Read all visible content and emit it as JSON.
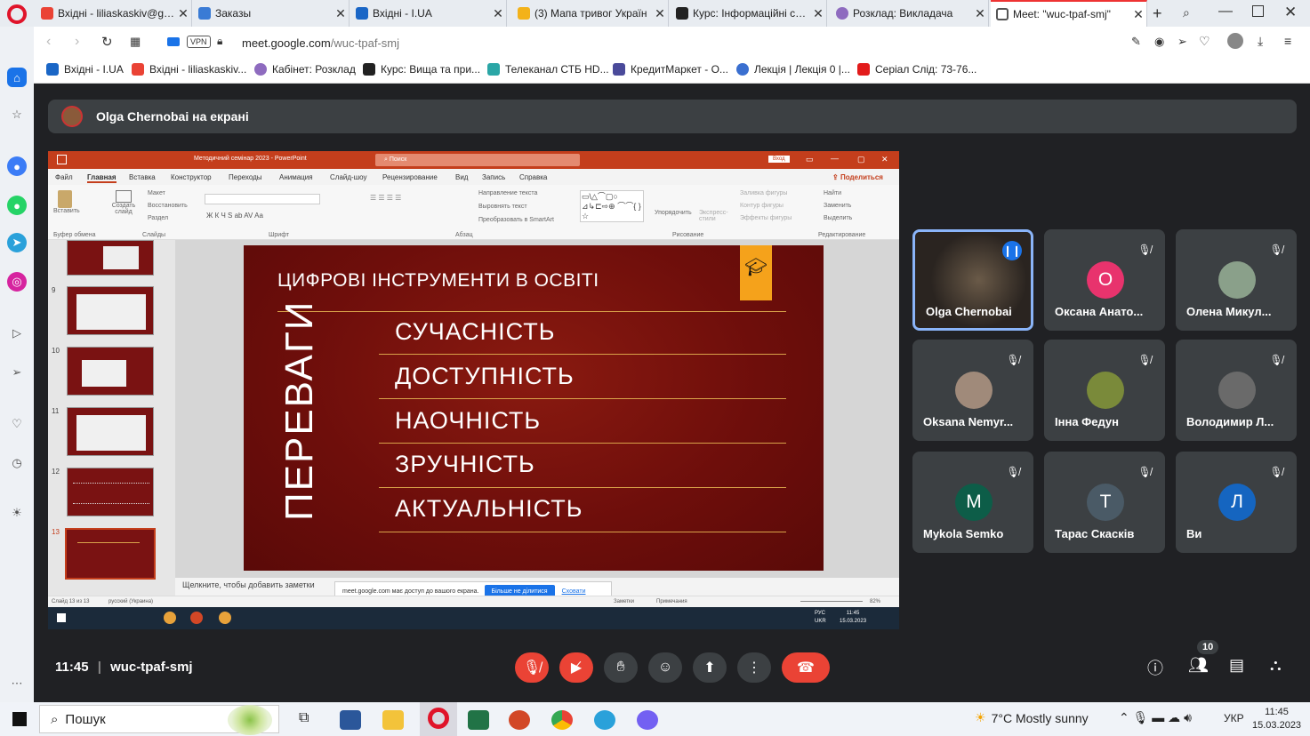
{
  "browser": {
    "tabs": [
      {
        "label": "Вхідні - liliaskaskiv@gma",
        "color": "#ea4335"
      },
      {
        "label": "Заказы",
        "color": "#3a7bd5"
      },
      {
        "label": "Вхідні - I.UA",
        "color": "#1a66c6"
      },
      {
        "label": "(3) Мапа тривог Україн",
        "color": "#f3b21a"
      },
      {
        "label": "Курс: Інформаційні сист",
        "color": "#222222"
      },
      {
        "label": "Розклад: Викладача",
        "color": "#8e6bbf"
      },
      {
        "label": "Meet: \"wuc-tpaf-smj\"",
        "color": "#1a73e8"
      }
    ],
    "url_domain": "meet.google.com",
    "url_path": "/wuc-tpaf-smj",
    "vpn_label": "VPN",
    "bookmarks": [
      {
        "label": "Вхідні - I.UA",
        "color": "#1a66c6"
      },
      {
        "label": "Вхідні - liliaskaskiv...",
        "color": "#ea4335"
      },
      {
        "label": "Кабінет: Розклад",
        "color": "#8e6bbf"
      },
      {
        "label": "Курс: Вища та при...",
        "color": "#222222"
      },
      {
        "label": "Телеканал СТБ HD...",
        "color": "#2aa6a6"
      },
      {
        "label": "КредитМаркет - О...",
        "color": "#4a4a9a"
      },
      {
        "label": "Лекція | Лекція 0 |...",
        "color": "#3a6fd0"
      },
      {
        "label": "Серіал Слід: 73-76...",
        "color": "#e21b1b"
      }
    ]
  },
  "meet": {
    "presenter_text": "Olga Chernobai на екрані",
    "time": "11:45",
    "meeting_code": "wuc-tpaf-smj",
    "participants_count": "10",
    "tiles": [
      {
        "name": "Olga Chernobai",
        "initial": "",
        "color": "#5a4a3a",
        "speaking": true
      },
      {
        "name": "Оксана Анато...",
        "initial": "О",
        "color": "#e8336d"
      },
      {
        "name": "Олена Микул...",
        "initial": "",
        "color": "#8aa08a"
      },
      {
        "name": "Oksana Nemyr...",
        "initial": "",
        "color": "#a08a7a"
      },
      {
        "name": "Інна Федун",
        "initial": "",
        "color": "#7a8a3a"
      },
      {
        "name": "Володимир Л...",
        "initial": "",
        "color": "#6a6a6a"
      },
      {
        "name": "Mykola Semko",
        "initial": "M",
        "color": "#0d5d48"
      },
      {
        "name": "Тарас Скасків",
        "initial": "Т",
        "color": "#4a5a66"
      },
      {
        "name": "Ви",
        "initial": "Л",
        "color": "#1565c0"
      }
    ]
  },
  "ppt": {
    "title": "Методичний семінар 2023 - PowerPoint",
    "search": "Поиск",
    "signin": "Вход",
    "share": "Поделиться",
    "menu": [
      "Файл",
      "Главная",
      "Вставка",
      "Конструктор",
      "Переходы",
      "Анимация",
      "Слайд-шоу",
      "Рецензирование",
      "Вид",
      "Запись",
      "Справка"
    ],
    "ribbon_groups": [
      "Буфер обмена",
      "Слайды",
      "Шрифт",
      "Абзац",
      "Рисование",
      "Редактирование"
    ],
    "ribbon_buttons": {
      "paste": "Вставить",
      "new_slide": "Создать слайд",
      "layout": "Макет",
      "reset": "Восстановить",
      "section": "Раздел",
      "text_direction": "Направление текста",
      "align_text": "Выровнять текст",
      "smartart": "Преобразовать в SmartArt",
      "arrange": "Упорядочить",
      "quick_styles": "Экспресс-стили",
      "shape_fill": "Заливка фигуры",
      "shape_outline": "Контур фигуры",
      "shape_effects": "Эффекты фигуры",
      "find": "Найти",
      "replace": "Заменить",
      "select": "Выделить"
    },
    "thumb_numbers": [
      "9",
      "10",
      "11",
      "12",
      "13"
    ],
    "notes_placeholder": "Щелкните, чтобы добавить заметки",
    "status_slide": "Слайд 13 из 13",
    "status_lang": "русский (Украина)",
    "status_notes": "Заметки",
    "status_comments": "Примечания",
    "zoom": "82%",
    "share_notice": "meet.google.com має доступ до вашого екрана.",
    "share_stop": "Більше не ділитися",
    "share_hide": "Сховати",
    "inner_taskbar": {
      "lang1": "РУС",
      "lang2": "UKR",
      "time": "11:45",
      "date": "15.03.2023"
    }
  },
  "slide": {
    "title": "ЦИФРОВІ ІНСТРУМЕНТИ В ОСВІТІ",
    "vertical": "ПЕРЕВАГИ",
    "items": [
      "СУЧАСНІСТЬ",
      "ДОСТУПНІСТЬ",
      "НАОЧНІСТЬ",
      "ЗРУЧНІСТЬ",
      "АКТУАЛЬНІСТЬ"
    ],
    "accent": "#f5a21b"
  },
  "windows": {
    "search_label": "Пошук",
    "weather": "7°C  Mostly sunny",
    "lang": "УКР",
    "time": "11:45",
    "date": "15.03.2023"
  }
}
